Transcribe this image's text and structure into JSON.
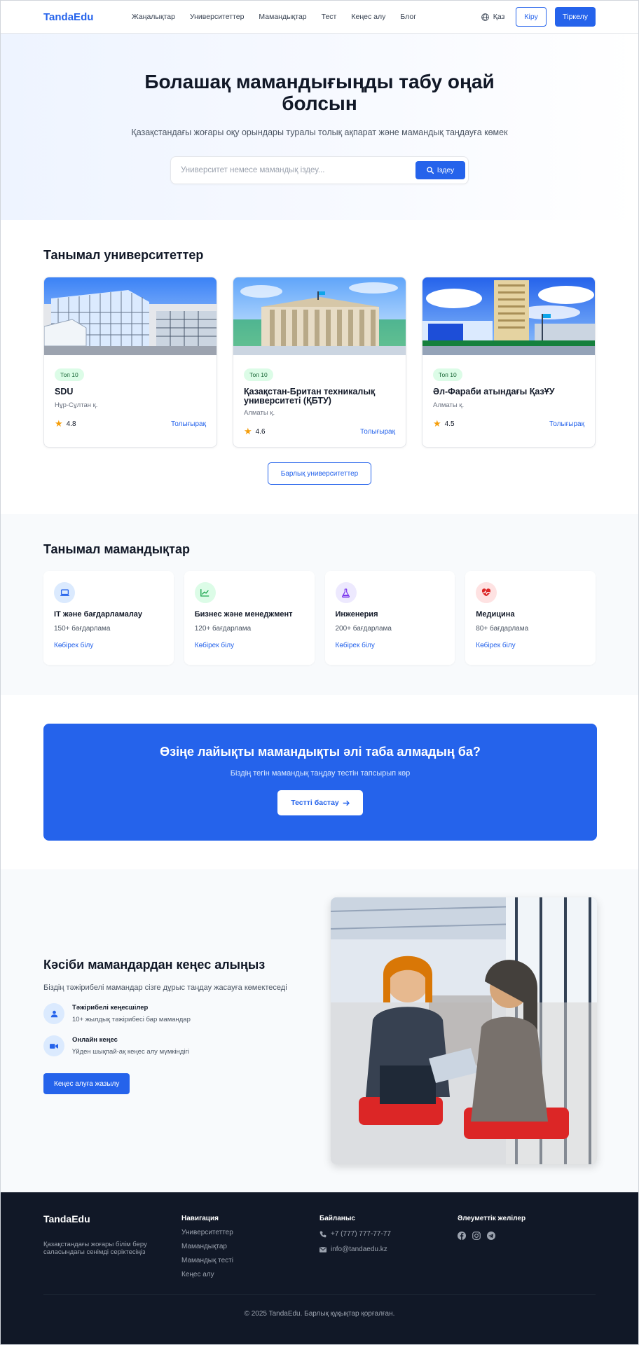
{
  "header": {
    "logo": "TandaEdu",
    "nav": [
      "Жаңалықтар",
      "Университеттер",
      "Мамандықтар",
      "Тест",
      "Кеңес алу",
      "Блог"
    ],
    "lang": "Қаз",
    "login": "Кіру",
    "register": "Тіркелу"
  },
  "hero": {
    "title": "Болашақ мамандығыңды табу оңай болсын",
    "subtitle": "Қазақстандағы жоғары оқу орындары туралы толық ақпарат және мамандық таңдауға көмек",
    "search_placeholder": "Университет немесе мамандық іздеу...",
    "search_button": "Іздеу"
  },
  "universities": {
    "title": "Танымал университеттер",
    "all_button": "Барлық университеттер",
    "items": [
      {
        "badge": "Топ 10",
        "name": "SDU",
        "city": "Нұр-Сұлтан қ.",
        "rating": "4.8",
        "more": "Толығырақ"
      },
      {
        "badge": "Топ 10",
        "name": "Қазақстан-Британ техникалық университеті (ҚБТУ)",
        "city": "Алматы қ.",
        "rating": "4.6",
        "more": "Толығырақ"
      },
      {
        "badge": "Топ 10",
        "name": "Әл-Фараби атындағы ҚазҰУ",
        "city": "Алматы қ.",
        "rating": "4.5",
        "more": "Толығырақ"
      }
    ]
  },
  "specialties": {
    "title": "Танымал мамандықтар",
    "items": [
      {
        "name": "IT және бағдарламалау",
        "count": "150+ бағдарлама",
        "more": "Көбірек білу",
        "icon": "laptop-icon",
        "color": "#2563eb",
        "bg": "#dbeafe"
      },
      {
        "name": "Бизнес және менеджмент",
        "count": "120+ бағдарлама",
        "more": "Көбірек білу",
        "icon": "chart-icon",
        "color": "#16a34a",
        "bg": "#dcfce7"
      },
      {
        "name": "Инженерия",
        "count": "200+ бағдарлама",
        "more": "Көбірек білу",
        "icon": "flask-icon",
        "color": "#7c3aed",
        "bg": "#ede9fe"
      },
      {
        "name": "Медицина",
        "count": "80+ бағдарлама",
        "more": "Көбірек білу",
        "icon": "heartbeat-icon",
        "color": "#dc2626",
        "bg": "#fee2e2"
      }
    ]
  },
  "cta": {
    "title": "Өзіңе лайықты мамандықты әлі таба алмадың ба?",
    "subtitle": "Біздің тегін мамандық таңдау тестін тапсырып көр",
    "button": "Тестті бастау"
  },
  "consult": {
    "title": "Кәсіби мамандардан кеңес алыңыз",
    "subtitle": "Біздің тәжірибелі мамандар сізге дұрыс таңдау жасауға көмектеседі",
    "features": [
      {
        "title": "Тәжірибелі кеңесшілер",
        "desc": "10+ жылдық тәжірибесі бар мамандар"
      },
      {
        "title": "Онлайн кеңес",
        "desc": "Үйден шықпай-ақ кеңес алу мүмкіндігі"
      }
    ],
    "button": "Кеңес алуға жазылу"
  },
  "footer": {
    "logo": "TandaEdu",
    "text": "Қазақстандағы жоғары білім беру саласындағы сенімді серіктесіңіз",
    "nav_title": "Навигация",
    "nav": [
      "Университеттер",
      "Мамандықтар",
      "Мамандық тесті",
      "Кеңес алу"
    ],
    "contact_title": "Байланыс",
    "phone": "+7 (777) 777-77-77",
    "email": "info@tandaedu.kz",
    "social_title": "Әлеуметтік желілер",
    "social": [
      "facebook-icon",
      "instagram-icon",
      "telegram-icon"
    ],
    "copyright": "© 2025 TandaEdu. Барлық құқықтар қорғалған."
  },
  "colors": {
    "accent": "#2563eb",
    "dark": "#111827"
  }
}
